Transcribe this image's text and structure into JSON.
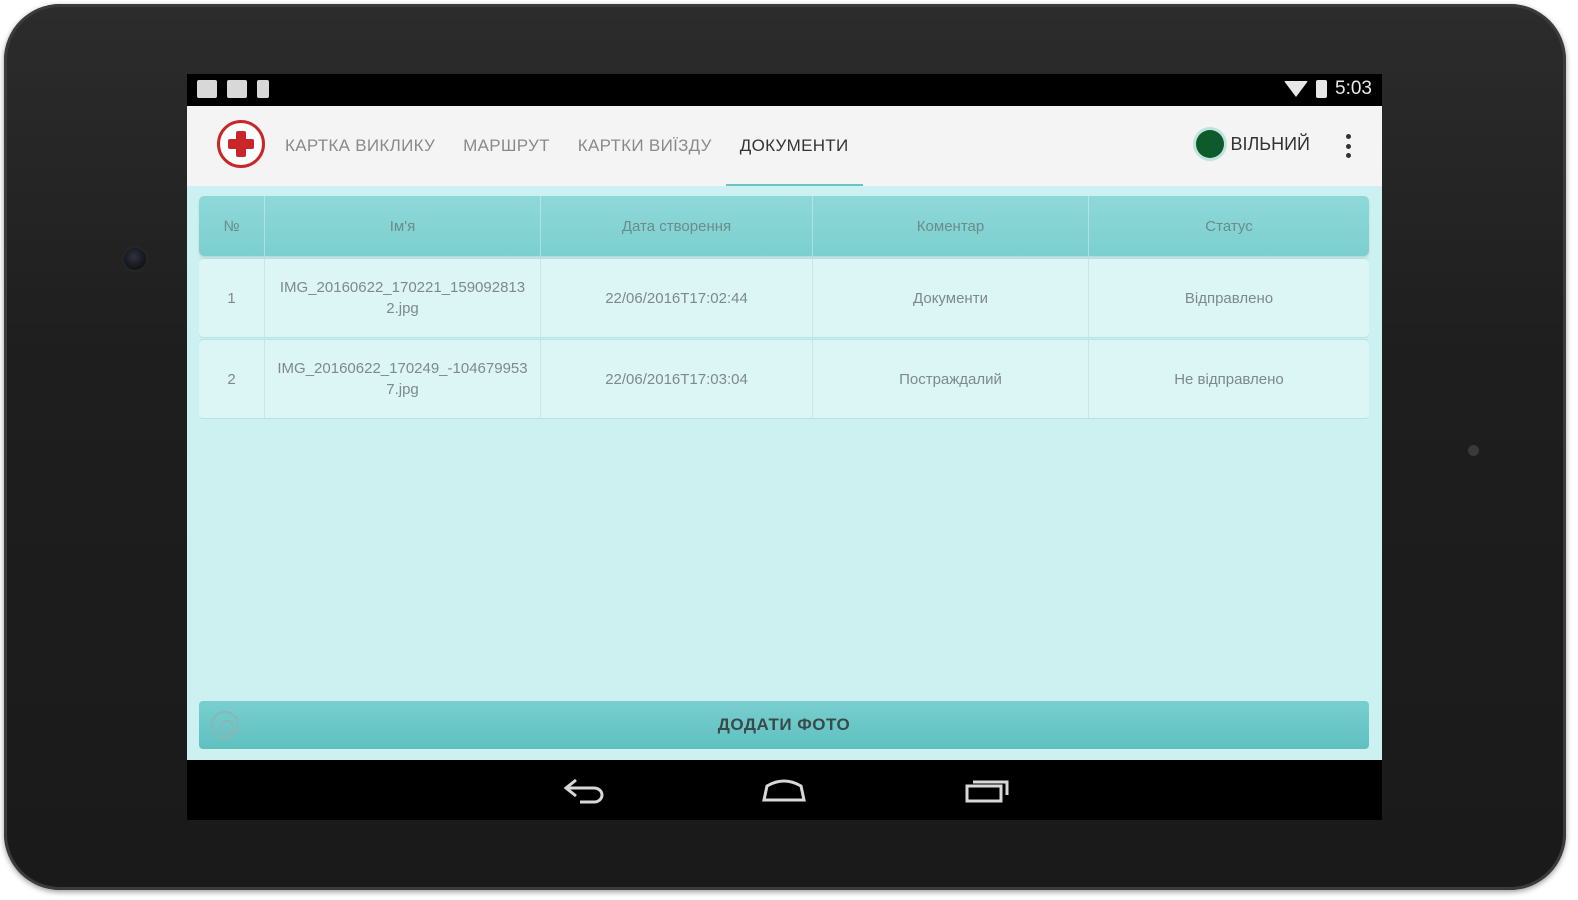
{
  "status_bar": {
    "time": "5:03",
    "left_icons": [
      "gallery-icon",
      "photo-icon",
      "sd-card-icon"
    ],
    "right_icons": [
      "wifi-icon",
      "battery-icon"
    ]
  },
  "app_bar": {
    "logo_icon": "medical-cross-icon",
    "tabs": [
      {
        "label": "КАРТКА ВИКЛИКУ",
        "active": false
      },
      {
        "label": "МАРШРУТ",
        "active": false
      },
      {
        "label": "КАРТКИ ВИЇЗДУ",
        "active": false
      },
      {
        "label": "ДОКУМЕНТИ",
        "active": true
      }
    ],
    "status_label": "ВІЛЬНИЙ",
    "status_color": "#0d5a2a",
    "menu_icon": "more-vert-icon"
  },
  "table": {
    "headers": [
      "№",
      "Ім'я",
      "Дата створення",
      "Коментар",
      "Статус"
    ],
    "rows": [
      {
        "num": "1",
        "name": "IMG_20160622_170221_1590928132.jpg",
        "date": "22/06/2016T17:02:44",
        "comment": "Документи",
        "status": "Відправлено"
      },
      {
        "num": "2",
        "name": "IMG_20160622_170249_-1046799537.jpg",
        "date": "22/06/2016T17:03:04",
        "comment": "Постраждалий",
        "status": "Не відправлено"
      }
    ]
  },
  "add_photo": {
    "label": "ДОДАТИ ФОТО",
    "icon": "camera-icon"
  },
  "nav_bar": {
    "icons": [
      "back-icon",
      "home-icon",
      "recent-apps-icon"
    ]
  },
  "colors": {
    "accent": "#6cc3c4",
    "content_bg": "#cdf0f0",
    "header_bg": "#8fd8d8",
    "logo_red": "#c8262b"
  }
}
